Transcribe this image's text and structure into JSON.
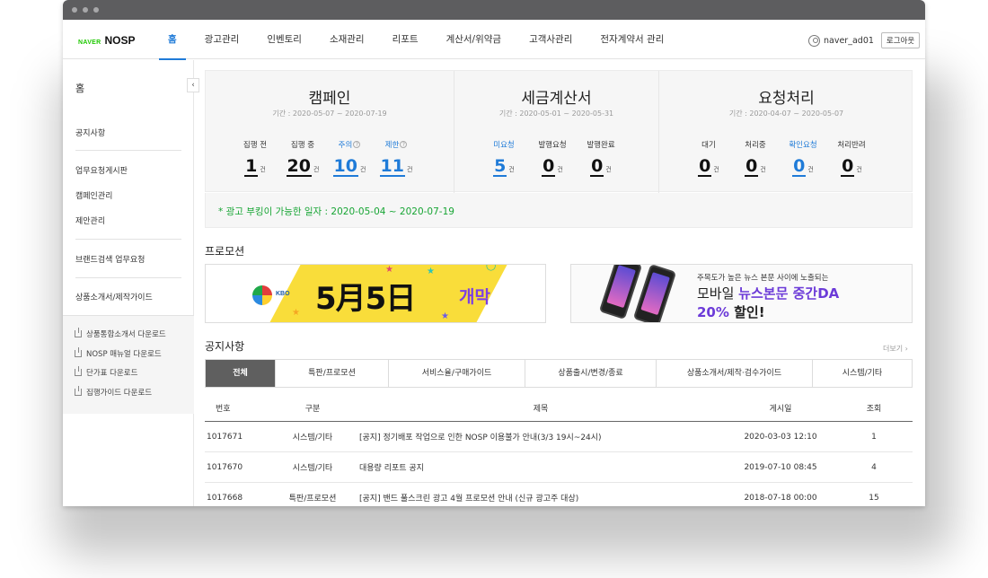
{
  "header": {
    "logo_naver": "NAVER",
    "logo_nosp": "NOSP",
    "menu": [
      {
        "label": "홈",
        "active": true
      },
      {
        "label": "광고관리"
      },
      {
        "label": "인벤토리"
      },
      {
        "label": "소재관리"
      },
      {
        "label": "리포트"
      },
      {
        "label": "계산서/위약금"
      },
      {
        "label": "고객사관리"
      },
      {
        "label": "전자계약서 관리"
      }
    ],
    "username": "naver_ad01",
    "logout_label": "로그아웃"
  },
  "sidebar": {
    "home": "홈",
    "collapse_icon": "‹",
    "links": [
      "공지사항",
      "업무요청게시판",
      "캠페인관리",
      "제안관리",
      "브랜드검색 업무요청",
      "상품소개서/제작가이드"
    ],
    "downloads": [
      "상품통합소개서 다운로드",
      "NOSP 매뉴얼 다운로드",
      "단가표 다운로드",
      "집행가이드 다운로드"
    ]
  },
  "summary": {
    "campaign": {
      "title": "캠페인",
      "period": "기간 : 2020-05-07 ~ 2020-07-19",
      "stats": [
        {
          "label": "집행 전",
          "value": "1",
          "unit": "건"
        },
        {
          "label": "집행 중",
          "value": "20",
          "unit": "건"
        },
        {
          "label": "주의",
          "value": "10",
          "unit": "건",
          "help": "?"
        },
        {
          "label": "제한",
          "value": "11",
          "unit": "건",
          "help": "?"
        }
      ]
    },
    "tax": {
      "title": "세금계산서",
      "period": "기간 : 2020-05-01 ~ 2020-05-31",
      "stats": [
        {
          "label": "미요청",
          "value": "5",
          "unit": "건"
        },
        {
          "label": "발행요청",
          "value": "0",
          "unit": "건"
        },
        {
          "label": "발행완료",
          "value": "0",
          "unit": "건"
        }
      ]
    },
    "request": {
      "title": "요청처리",
      "period": "기간 : 2020-04-07 ~ 2020-05-07",
      "stats": [
        {
          "label": "대기",
          "value": "0",
          "unit": "건"
        },
        {
          "label": "처리중",
          "value": "0",
          "unit": "건"
        },
        {
          "label": "확인요청",
          "value": "0",
          "unit": "건"
        },
        {
          "label": "처리반려",
          "value": "0",
          "unit": "건"
        }
      ]
    }
  },
  "booking_notice": "* 광고 부킹이 가능한 일자 : 2020-05-04 ~ 2020-07-19",
  "promotion": {
    "title": "프로모션",
    "banner1": {
      "logo_text": "KBO",
      "headline": "5月5日",
      "tag": "개막"
    },
    "banner2": {
      "line1": "주목도가 높은 뉴스 본문 사이에 노출되는",
      "line2_plain": "모바일 ",
      "line2_highlight": "뉴스본문 중간DA",
      "line3_highlight": "20%",
      "line3_plain": " 할인!"
    }
  },
  "notices": {
    "title": "공지사항",
    "more_label": "더보기 ›",
    "tabs": [
      {
        "label": "전체",
        "active": true
      },
      {
        "label": "특판/프로모션"
      },
      {
        "label": "서비스율/구매가이드"
      },
      {
        "label": "상품출시/변경/종료"
      },
      {
        "label": "상품소개서/제작·검수가이드"
      },
      {
        "label": "시스템/기타"
      }
    ],
    "columns": [
      "번호",
      "구분",
      "제목",
      "게시일",
      "조회"
    ],
    "rows": [
      {
        "no": "1017671",
        "category": "시스템/기타",
        "title": "[공지] 정기배포 작업으로 인한 NOSP 이용불가 안내(3/3 19시~24시)",
        "date": "2020-03-03 12:10",
        "views": "1"
      },
      {
        "no": "1017670",
        "category": "시스템/기타",
        "title": "대용량 리포트 공지",
        "date": "2019-07-10 08:45",
        "views": "4"
      },
      {
        "no": "1017668",
        "category": "특판/프로모션",
        "title": "[공지] 밴드 풀스크린 광고 4월 프로모션 안내 (신규 광고주 대상)",
        "date": "2018-07-18 00:00",
        "views": "15"
      }
    ]
  },
  "colors": {
    "accent": "#1f7bd8",
    "notice_green": "#17a534",
    "tab_active": "#5f5f5f"
  }
}
